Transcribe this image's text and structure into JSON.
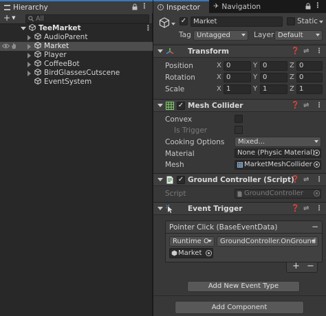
{
  "hierarchy": {
    "tab_label": "Hierarchy",
    "add_label": "+",
    "search_placeholder": "All",
    "scene_name": "TeeMarket",
    "items": [
      {
        "label": "AudioParent",
        "expandable": true
      },
      {
        "label": "Market",
        "expandable": true,
        "selected": true
      },
      {
        "label": "Player",
        "expandable": true
      },
      {
        "label": "CoffeeBot",
        "expandable": true
      },
      {
        "label": "BirdGlassesCutscene",
        "expandable": true
      },
      {
        "label": "EventSystem",
        "expandable": false
      }
    ]
  },
  "inspector": {
    "tabs": [
      "Inspector",
      "Navigation"
    ],
    "object_name": "Market",
    "static_label": "Static",
    "tag_label": "Tag",
    "tag_value": "Untagged",
    "layer_label": "Layer",
    "layer_value": "Default",
    "transform": {
      "title": "Transform",
      "rows": [
        {
          "label": "Position",
          "x": "0",
          "y": "0",
          "z": "0"
        },
        {
          "label": "Rotation",
          "x": "0",
          "y": "0",
          "z": "0"
        },
        {
          "label": "Scale",
          "x": "1",
          "y": "1",
          "z": "1"
        }
      ],
      "axes": [
        "X",
        "Y",
        "Z"
      ]
    },
    "mesh_collider": {
      "title": "Mesh Collider",
      "convex_label": "Convex",
      "is_trigger_label": "Is Trigger",
      "cooking_label": "Cooking Options",
      "cooking_value": "Mixed...",
      "material_label": "Material",
      "material_value": "None (Physic Material)",
      "mesh_label": "Mesh",
      "mesh_value": "MarketMeshCollider"
    },
    "ground_controller": {
      "title": "Ground Controller (Script)",
      "script_label": "Script",
      "script_value": "GroundController"
    },
    "event_trigger": {
      "title": "Event Trigger",
      "event_name": "Pointer Click (BaseEventData)",
      "remove_label": "−",
      "runtime_value": "Runtime O",
      "function_value": "GroundController.OnGround",
      "object_value": "Market",
      "plus_label": "+",
      "minus_label": "−",
      "add_event_type_label": "Add New Event Type"
    },
    "add_component_label": "Add Component"
  },
  "colors": {
    "accent": "#3a79bb",
    "selection": "#4d4d4d",
    "panel": "#383838"
  }
}
